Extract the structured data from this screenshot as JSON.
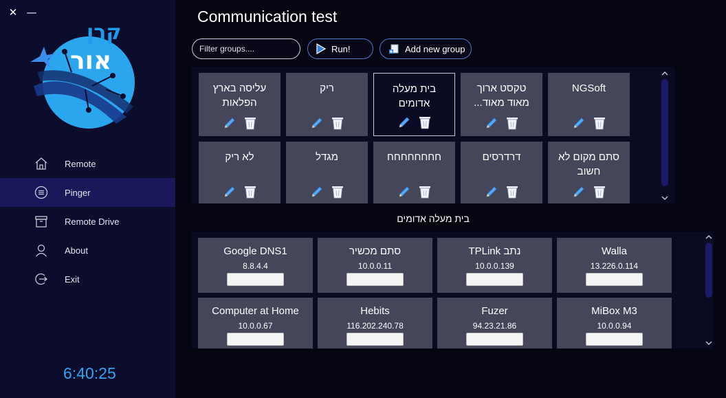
{
  "window": {
    "close_glyph": "✕",
    "minimize_glyph": "—"
  },
  "logo": {
    "text_top": "קרן",
    "text_main": "אור",
    "accent": "#1e9bea"
  },
  "nav": {
    "items": [
      {
        "label": "Remote",
        "icon": "home-icon"
      },
      {
        "label": "Pinger",
        "icon": "list-circle-icon",
        "active": true
      },
      {
        "label": "Remote Drive",
        "icon": "archive-box-icon"
      },
      {
        "label": "About",
        "icon": "person-icon"
      },
      {
        "label": "Exit",
        "icon": "exit-icon"
      }
    ]
  },
  "clock": "6:40:25",
  "main": {
    "title": "Communication test",
    "filter_placeholder": "Filter groups....",
    "run_label": "Run!",
    "add_group_label": "Add new group"
  },
  "groups": [
    {
      "name": "עליסה בארץ הפלאות"
    },
    {
      "name": "ריק"
    },
    {
      "name": "בית מעלה אדומים",
      "selected": true
    },
    {
      "name": "טקסט ארוך מאוד מאוד..."
    },
    {
      "name": "NGSoft"
    },
    {
      "name": "לא ריק"
    },
    {
      "name": "מגדל"
    },
    {
      "name": "חחחחחחחח"
    },
    {
      "name": "דרדרסים"
    },
    {
      "name": "סתם מקום לא חשוב"
    }
  ],
  "selected_group": "בית מעלה אדומים",
  "hosts": [
    {
      "name": "Google DNS1",
      "ip": "8.8.4.4"
    },
    {
      "name": "סתם מכשיר",
      "ip": "10.0.0.11"
    },
    {
      "name": "TPLink נתב",
      "ip": "10.0.0.139"
    },
    {
      "name": "Walla",
      "ip": "13.226.0.114"
    },
    {
      "name": "Computer at Home",
      "ip": "10.0.0.67"
    },
    {
      "name": "Hebits",
      "ip": "116.202.240.78"
    },
    {
      "name": "Fuzer",
      "ip": "94.23.21.86"
    },
    {
      "name": "MiBox M3",
      "ip": "10.0.0.94"
    }
  ],
  "colors": {
    "sidebar": "#0c0c2c",
    "nav_active": "#19195a",
    "tile": "#45465a",
    "accent": "#32a4f0",
    "pencil": "#5aa8f0"
  }
}
